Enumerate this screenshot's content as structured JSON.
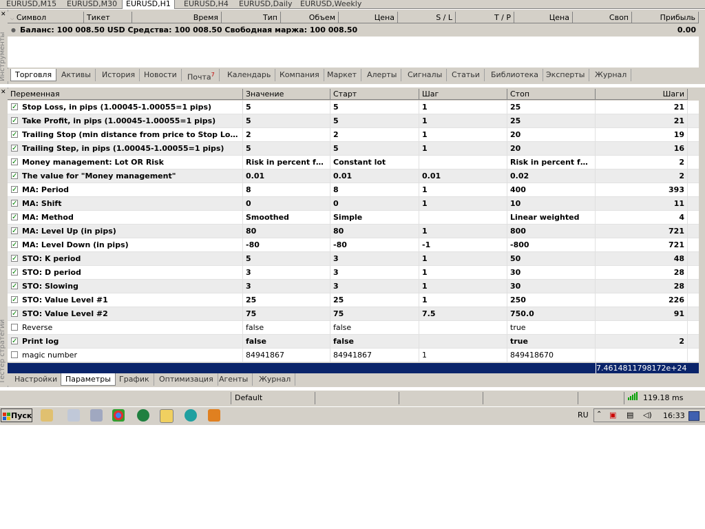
{
  "chart_tabs": [
    {
      "label": "EURUSD,M15",
      "active": false
    },
    {
      "label": "EURUSD,M30",
      "active": false
    },
    {
      "label": "EURUSD,H1",
      "active": true
    },
    {
      "label": "EURUSD,H4",
      "active": false
    },
    {
      "label": "EURUSD,Daily",
      "active": false
    },
    {
      "label": "EURUSD,Weekly",
      "active": false
    }
  ],
  "toolbox": {
    "side_label": "Инструменты",
    "columns": [
      "Символ",
      "Тикет",
      "Время",
      "Тип",
      "Объем",
      "Цена",
      "S / L",
      "T / P",
      "Цена",
      "Своп",
      "Прибыль"
    ],
    "balance_text": "Баланс: 100 008.50 USD  Средства: 100 008.50  Свободная маржа: 100 008.50",
    "balance_profit": "0.00",
    "tabs": [
      "Торговля",
      "Активы",
      "История",
      "Новости",
      "Почта",
      "Календарь",
      "Компания",
      "Маркет",
      "Алерты",
      "Сигналы",
      "Статьи",
      "Библиотека",
      "Эксперты",
      "Журнал"
    ],
    "mail_badge": "7"
  },
  "tester": {
    "side_label": "Тестер стратегии",
    "columns": [
      "Переменная",
      "Значение",
      "Старт",
      "Шаг",
      "Стоп",
      "Шаги"
    ],
    "rows": [
      {
        "checked": true,
        "bold": true,
        "name": "Stop Loss, in pips (1.00045-1.00055=1 pips)",
        "value": "5",
        "start": "5",
        "step": "1",
        "stop": "25",
        "steps": "21"
      },
      {
        "checked": true,
        "bold": true,
        "name": "Take Profit, in pips (1.00045-1.00055=1 pips)",
        "value": "5",
        "start": "5",
        "step": "1",
        "stop": "25",
        "steps": "21"
      },
      {
        "checked": true,
        "bold": true,
        "name": "Trailing Stop (min distance from price to Stop Loss, in ...",
        "value": "2",
        "start": "2",
        "step": "1",
        "stop": "20",
        "steps": "19"
      },
      {
        "checked": true,
        "bold": true,
        "name": "Trailing Step, in pips (1.00045-1.00055=1 pips)",
        "value": "5",
        "start": "5",
        "step": "1",
        "stop": "20",
        "steps": "16"
      },
      {
        "checked": true,
        "bold": true,
        "name": "Money management: Lot OR Risk",
        "value": "Risk in percent for ...",
        "start": "Constant lot",
        "step": "",
        "stop": "Risk in percent for ...",
        "steps": "2"
      },
      {
        "checked": true,
        "bold": true,
        "name": "The value for \"Money management\"",
        "value": "0.01",
        "start": "0.01",
        "step": "0.01",
        "stop": "0.02",
        "steps": "2"
      },
      {
        "checked": true,
        "bold": true,
        "name": "MA: Period",
        "value": "8",
        "start": "8",
        "step": "1",
        "stop": "400",
        "steps": "393"
      },
      {
        "checked": true,
        "bold": true,
        "name": "MA: Shift",
        "value": "0",
        "start": "0",
        "step": "1",
        "stop": "10",
        "steps": "11"
      },
      {
        "checked": true,
        "bold": true,
        "name": "MA: Method",
        "value": "Smoothed",
        "start": "Simple",
        "step": "",
        "stop": "Linear weighted",
        "steps": "4"
      },
      {
        "checked": true,
        "bold": true,
        "name": "MA: Level Up (in pips)",
        "value": "80",
        "start": "80",
        "step": "1",
        "stop": "800",
        "steps": "721"
      },
      {
        "checked": true,
        "bold": true,
        "name": "MA: Level Down (in pips)",
        "value": "-80",
        "start": "-80",
        "step": "-1",
        "stop": "-800",
        "steps": "721"
      },
      {
        "checked": true,
        "bold": true,
        "name": "STO: K period",
        "value": "5",
        "start": "3",
        "step": "1",
        "stop": "50",
        "steps": "48"
      },
      {
        "checked": true,
        "bold": true,
        "name": "STO: D period",
        "value": "3",
        "start": "3",
        "step": "1",
        "stop": "30",
        "steps": "28"
      },
      {
        "checked": true,
        "bold": true,
        "name": "STO: Slowing",
        "value": "3",
        "start": "3",
        "step": "1",
        "stop": "30",
        "steps": "28"
      },
      {
        "checked": true,
        "bold": true,
        "name": "STO: Value Level #1",
        "value": "25",
        "start": "25",
        "step": "1",
        "stop": "250",
        "steps": "226"
      },
      {
        "checked": true,
        "bold": true,
        "name": "STO: Value Level #2",
        "value": "75",
        "start": "75",
        "step": "7.5",
        "stop": "750.0",
        "steps": "91"
      },
      {
        "checked": false,
        "bold": false,
        "name": "Reverse",
        "value": "false",
        "start": "false",
        "step": "",
        "stop": "true",
        "steps": ""
      },
      {
        "checked": true,
        "bold": true,
        "name": "Print log",
        "value": "false",
        "start": "false",
        "step": "",
        "stop": "true",
        "steps": "2"
      },
      {
        "checked": false,
        "bold": false,
        "name": "magic number",
        "value": "84941867",
        "start": "84941867",
        "step": "1",
        "stop": "849418670",
        "steps": ""
      }
    ],
    "total_steps": "7.4614811798172e+24",
    "tabs": [
      "Настройки",
      "Параметры",
      "График",
      "Оптимизация",
      "Агенты",
      "Журнал"
    ],
    "active_tab": "Параметры"
  },
  "status_bar": {
    "profile": "Default",
    "ping": "119.18 ms"
  },
  "taskbar": {
    "start_label": "Пуск",
    "language": "RU",
    "clock": "16:33"
  }
}
